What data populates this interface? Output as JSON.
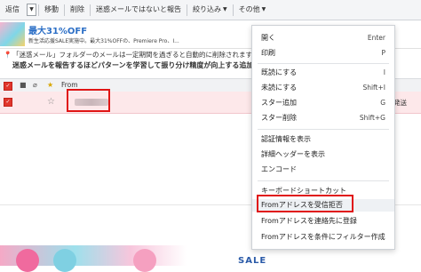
{
  "toolbar": {
    "reply": "返信",
    "move": "移動",
    "delete": "削除",
    "not_spam": "迷惑メールではないと報告",
    "filter": "絞り込み",
    "other": "その他"
  },
  "promo": {
    "title": "最大31%OFF",
    "subtitle": "新生活応援SALE実施中。最大31%OFFの、Premiere Pro、I..."
  },
  "notice": {
    "line1": "「迷惑メール」フォルダーのメールは一定期間を過ぎると自動的に削除されます",
    "line2": "迷惑メールを報告するほどパターンを学習して振り分け精度が向上する追加サー"
  },
  "table": {
    "from_header": "From"
  },
  "row": {
    "right_text": "発送"
  },
  "menu": {
    "items": [
      {
        "label": "開く",
        "shortcut": "Enter"
      },
      {
        "label": "印刷",
        "shortcut": "P"
      },
      {
        "label": "既読にする",
        "shortcut": "I"
      },
      {
        "label": "未読にする",
        "shortcut": "Shift+I"
      },
      {
        "label": "スター追加",
        "shortcut": "G"
      },
      {
        "label": "スター削除",
        "shortcut": "Shift+G"
      },
      {
        "label": "認証情報を表示",
        "shortcut": ""
      },
      {
        "label": "詳細ヘッダーを表示",
        "shortcut": ""
      },
      {
        "label": "エンコード",
        "shortcut": ""
      },
      {
        "label": "キーボードショートカット",
        "shortcut": ""
      },
      {
        "label": "Fromアドレスを受信拒否",
        "shortcut": ""
      },
      {
        "label": "Fromアドレスを連絡先に登録",
        "shortcut": ""
      },
      {
        "label": "Fromアドレスを条件にフィルター作成",
        "shortcut": ""
      }
    ]
  },
  "banner": {
    "sale": "SALE"
  },
  "colors": {
    "highlight": "#e01515",
    "brand_blue": "#2c6fc6",
    "selected_row": "#fde8ea"
  }
}
